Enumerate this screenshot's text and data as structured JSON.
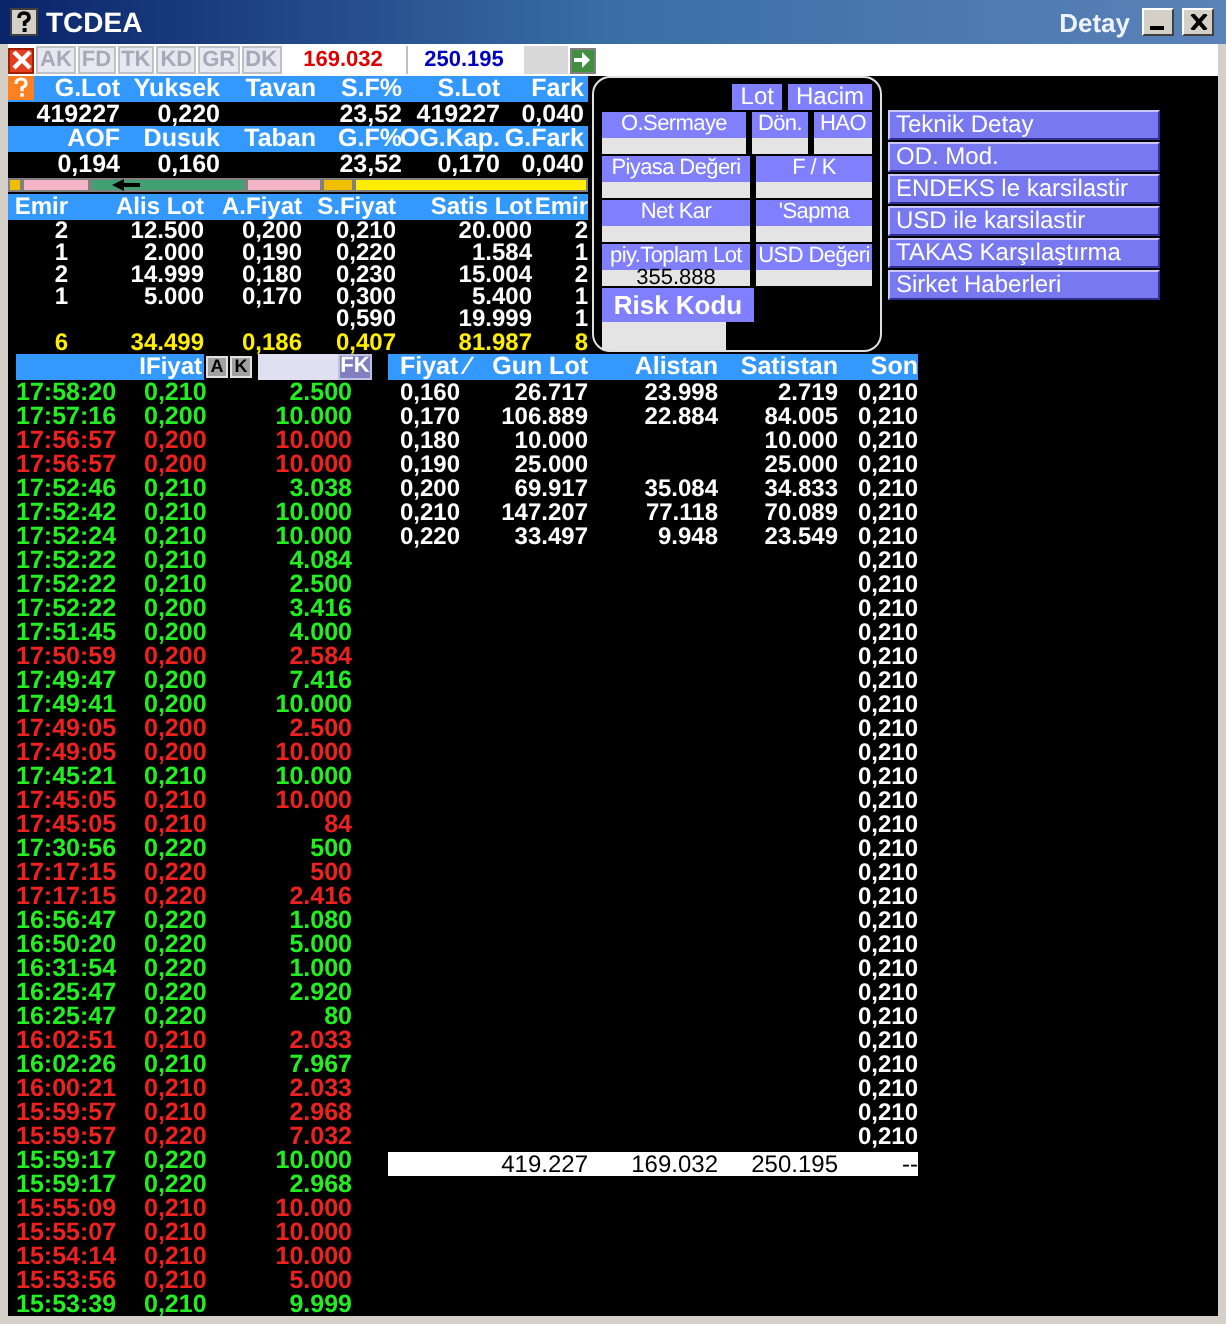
{
  "window": {
    "title": "TCDEA",
    "subtitle": "Detay"
  },
  "toolbar": {
    "tabs": [
      {
        "label": "AK",
        "disabled": true
      },
      {
        "label": "FD",
        "disabled": true
      },
      {
        "label": "TK",
        "disabled": true
      },
      {
        "label": "KD",
        "disabled": true
      },
      {
        "label": "GR",
        "disabled": true
      },
      {
        "label": "DK",
        "disabled": true
      }
    ],
    "buy_total": "169.032",
    "sell_total": "250.195"
  },
  "summary": [
    [
      {
        "label": "G.Lot",
        "value": "419227"
      },
      {
        "label": "Yuksek",
        "value": "0,220"
      },
      {
        "label": "Tavan"
      },
      {
        "label": "S.F%",
        "value": "23,52"
      },
      {
        "label": "S.Lot",
        "value": "419227"
      },
      {
        "label": "Fark",
        "value": "0,040"
      }
    ],
    [
      {
        "label": "AOF",
        "value": "0,194"
      },
      {
        "label": "Dusuk",
        "value": "0,160"
      },
      {
        "label": "Taban"
      },
      {
        "label": "G.F%",
        "value": "23,52"
      },
      {
        "label": "OG.Kap.",
        "value": "0,170"
      },
      {
        "label": "G.Fark",
        "value": "0,040"
      }
    ]
  ],
  "depth": {
    "columns": [
      "Emir",
      "Alis Lot",
      "A.Fiyat",
      "S.Fiyat",
      "Satis Lot",
      "Emir"
    ],
    "rows": [
      [
        "2",
        "12.500",
        "0,200",
        "0,210",
        "20.000",
        "2"
      ],
      [
        "1",
        "2.000",
        "0,190",
        "0,220",
        "1.584",
        "1"
      ],
      [
        "2",
        "14.999",
        "0,180",
        "0,230",
        "15.004",
        "2"
      ],
      [
        "1",
        "5.000",
        "0,170",
        "0,300",
        "5.400",
        "1"
      ],
      [
        null,
        null,
        null,
        "0,590",
        "19.999",
        "1"
      ]
    ],
    "totals": [
      "6",
      "34.499",
      "0,186",
      "0,407",
      "81.987",
      "8"
    ]
  },
  "info_panel": {
    "toggles": [
      "Lot",
      "Hacim"
    ],
    "rows": [
      [
        {
          "label": "O.Sermaye",
          "kind": "small"
        },
        {
          "label": "Dön.",
          "kind": "small"
        },
        {
          "label": "HAO",
          "kind": "small"
        }
      ],
      [
        {
          "label": "Piyasa Değeri",
          "kind": "small"
        },
        {
          "label": "F / K",
          "kind": "small"
        }
      ],
      [
        {
          "label": "Net Kar",
          "kind": "small"
        },
        {
          "label": "'Sapma",
          "kind": "small"
        }
      ],
      [
        {
          "label": "piy.Toplam Lot",
          "kind": "small",
          "value": "355.888"
        },
        {
          "label": "USD Değeri",
          "kind": "small"
        }
      ],
      [
        {
          "label": "Risk Kodu",
          "kind": "large"
        }
      ]
    ]
  },
  "menu": [
    "Teknik Detay",
    "OD. Mod.",
    "ENDEKS le karsilastir",
    "USD ile karsilastir",
    "TAKAS Karşılaştırma",
    "Sirket Haberleri"
  ],
  "trades": {
    "header": "IFiyat",
    "buttons": [
      "A",
      "K"
    ],
    "filter_button": "FK",
    "rows": [
      {
        "time": "17:58:20",
        "price": "0,210",
        "lot": "2.500",
        "color": "#22ee22"
      },
      {
        "time": "17:57:16",
        "price": "0,200",
        "lot": "10.000",
        "color": "#22ee22"
      },
      {
        "time": "17:56:57",
        "price": "0,200",
        "lot": "10.000",
        "color": "#ee2020"
      },
      {
        "time": "17:56:57",
        "price": "0,200",
        "lot": "10.000",
        "color": "#ee2020"
      },
      {
        "time": "17:52:46",
        "price": "0,210",
        "lot": "3.038",
        "color": "#22ee22"
      },
      {
        "time": "17:52:42",
        "price": "0,210",
        "lot": "10.000",
        "color": "#22ee22"
      },
      {
        "time": "17:52:24",
        "price": "0,210",
        "lot": "10.000",
        "color": "#22ee22"
      },
      {
        "time": "17:52:22",
        "price": "0,210",
        "lot": "4.084",
        "color": "#22ee22"
      },
      {
        "time": "17:52:22",
        "price": "0,210",
        "lot": "2.500",
        "color": "#22ee22"
      },
      {
        "time": "17:52:22",
        "price": "0,200",
        "lot": "3.416",
        "color": "#22ee22"
      },
      {
        "time": "17:51:45",
        "price": "0,200",
        "lot": "4.000",
        "color": "#22ee22"
      },
      {
        "time": "17:50:59",
        "price": "0,200",
        "lot": "2.584",
        "color": "#ee2020"
      },
      {
        "time": "17:49:47",
        "price": "0,200",
        "lot": "7.416",
        "color": "#22ee22"
      },
      {
        "time": "17:49:41",
        "price": "0,200",
        "lot": "10.000",
        "color": "#22ee22"
      },
      {
        "time": "17:49:05",
        "price": "0,200",
        "lot": "2.500",
        "color": "#ee2020"
      },
      {
        "time": "17:49:05",
        "price": "0,200",
        "lot": "10.000",
        "color": "#ee2020"
      },
      {
        "time": "17:45:21",
        "price": "0,210",
        "lot": "10.000",
        "color": "#22ee22"
      },
      {
        "time": "17:45:05",
        "price": "0,210",
        "lot": "10.000",
        "color": "#ee2020"
      },
      {
        "time": "17:45:05",
        "price": "0,210",
        "lot": "84",
        "color": "#ee2020"
      },
      {
        "time": "17:30:56",
        "price": "0,220",
        "lot": "500",
        "color": "#22ee22"
      },
      {
        "time": "17:17:15",
        "price": "0,220",
        "lot": "500",
        "color": "#ee2020"
      },
      {
        "time": "17:17:15",
        "price": "0,220",
        "lot": "2.416",
        "color": "#ee2020"
      },
      {
        "time": "16:56:47",
        "price": "0,220",
        "lot": "1.080",
        "color": "#22ee22"
      },
      {
        "time": "16:50:20",
        "price": "0,220",
        "lot": "5.000",
        "color": "#22ee22"
      },
      {
        "time": "16:31:54",
        "price": "0,220",
        "lot": "1.000",
        "color": "#22ee22"
      },
      {
        "time": "16:25:47",
        "price": "0,220",
        "lot": "2.920",
        "color": "#22ee22"
      },
      {
        "time": "16:25:47",
        "price": "0,220",
        "lot": "80",
        "color": "#22ee22"
      },
      {
        "time": "16:02:51",
        "price": "0,210",
        "lot": "2.033",
        "color": "#ee2020"
      },
      {
        "time": "16:02:26",
        "price": "0,210",
        "lot": "7.967",
        "color": "#22ee22"
      },
      {
        "time": "16:00:21",
        "price": "0,210",
        "lot": "2.033",
        "color": "#ee2020"
      },
      {
        "time": "15:59:57",
        "price": "0,210",
        "lot": "2.968",
        "color": "#ee2020"
      },
      {
        "time": "15:59:57",
        "price": "0,220",
        "lot": "7.032",
        "color": "#ee2020"
      },
      {
        "time": "15:59:17",
        "price": "0,220",
        "lot": "10.000",
        "color": "#22ee22"
      },
      {
        "time": "15:59:17",
        "price": "0,220",
        "lot": "2.968",
        "color": "#22ee22"
      },
      {
        "time": "15:55:09",
        "price": "0,210",
        "lot": "10.000",
        "color": "#ee2020"
      },
      {
        "time": "15:55:07",
        "price": "0,210",
        "lot": "10.000",
        "color": "#ee2020"
      },
      {
        "time": "15:54:14",
        "price": "0,210",
        "lot": "10.000",
        "color": "#ee2020"
      },
      {
        "time": "15:53:56",
        "price": "0,210",
        "lot": "5.000",
        "color": "#ee2020"
      },
      {
        "time": "15:53:39",
        "price": "0,210",
        "lot": "9.999",
        "color": "#22ee22"
      }
    ]
  },
  "price_table": {
    "columns": [
      "Fiyat ∕",
      "Gun Lot",
      "Alistan",
      "Satistan",
      "Son"
    ],
    "rows": [
      {
        "fiyat": "0,160",
        "gun_lot": "26.717",
        "alistan": "23.998",
        "satistan": "2.719"
      },
      {
        "fiyat": "0,170",
        "gun_lot": "106.889",
        "alistan": "22.884",
        "satistan": "84.005"
      },
      {
        "fiyat": "0,180",
        "gun_lot": "10.000",
        "satistan": "10.000"
      },
      {
        "fiyat": "0,190",
        "gun_lot": "25.000",
        "satistan": "25.000"
      },
      {
        "fiyat": "0,200",
        "gun_lot": "69.917",
        "alistan": "35.084",
        "satistan": "34.833"
      },
      {
        "fiyat": "0,210",
        "gun_lot": "147.207",
        "alistan": "77.118",
        "satistan": "70.089"
      },
      {
        "fiyat": "0,220",
        "gun_lot": "33.497",
        "alistan": "9.948",
        "satistan": "23.549"
      }
    ],
    "son": [
      "0,210",
      "0,210",
      "0,210",
      "0,210",
      "0,210",
      "0,210",
      "0,210",
      "0,210",
      "0,210",
      "0,210",
      "0,210",
      "0,210",
      "0,210",
      "0,210",
      "0,210",
      "0,210",
      "0,210",
      "0,210",
      "0,210",
      "0,210",
      "0,210",
      "0,210",
      "0,210",
      "0,210",
      "0,210",
      "0,210",
      "0,210",
      "0,210",
      "0,210",
      "0,210",
      "0,210",
      "0,210"
    ],
    "totals": {
      "gun_lot": "419.227",
      "alistan": "169.032",
      "satistan": "250.195",
      "son": "--"
    }
  }
}
